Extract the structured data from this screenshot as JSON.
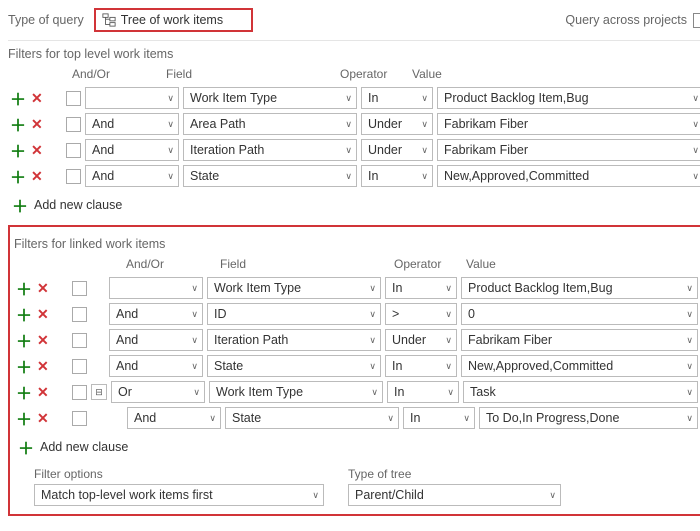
{
  "header": {
    "typeOfQueryLabel": "Type of query",
    "queryType": "Tree of work items",
    "acrossLabel": "Query across projects"
  },
  "topSection": {
    "title": "Filters for top level work items",
    "columns": {
      "andor": "And/Or",
      "field": "Field",
      "op": "Operator",
      "val": "Value"
    },
    "rows": [
      {
        "andor": "",
        "field": "Work Item Type",
        "op": "In",
        "val": "Product Backlog Item,Bug"
      },
      {
        "andor": "And",
        "field": "Area Path",
        "op": "Under",
        "val": "Fabrikam Fiber"
      },
      {
        "andor": "And",
        "field": "Iteration Path",
        "op": "Under",
        "val": "Fabrikam Fiber"
      },
      {
        "andor": "And",
        "field": "State",
        "op": "In",
        "val": "New,Approved,Committed"
      }
    ],
    "addClause": "Add new clause"
  },
  "linkedSection": {
    "title": "Filters for linked work items",
    "columns": {
      "andor": "And/Or",
      "field": "Field",
      "op": "Operator",
      "val": "Value"
    },
    "rows": [
      {
        "andor": "",
        "field": "Work Item Type",
        "op": "In",
        "val": "Product Backlog Item,Bug",
        "group": false,
        "indent": 0
      },
      {
        "andor": "And",
        "field": "ID",
        "op": ">",
        "val": "0",
        "group": false,
        "indent": 0
      },
      {
        "andor": "And",
        "field": "Iteration Path",
        "op": "Under",
        "val": "Fabrikam Fiber",
        "group": false,
        "indent": 0
      },
      {
        "andor": "And",
        "field": "State",
        "op": "In",
        "val": "New,Approved,Committed",
        "group": false,
        "indent": 0
      },
      {
        "andor": "Or",
        "field": "Work Item Type",
        "op": "In",
        "val": "Task",
        "group": true,
        "indent": 0
      },
      {
        "andor": "And",
        "field": "State",
        "op": "In",
        "val": "To Do,In Progress,Done",
        "group": false,
        "indent": 1
      }
    ],
    "addClause": "Add new clause"
  },
  "bottom": {
    "filterOptionsLabel": "Filter options",
    "filterOptions": "Match top-level work items first",
    "treeTypeLabel": "Type of tree",
    "treeType": "Parent/Child"
  }
}
